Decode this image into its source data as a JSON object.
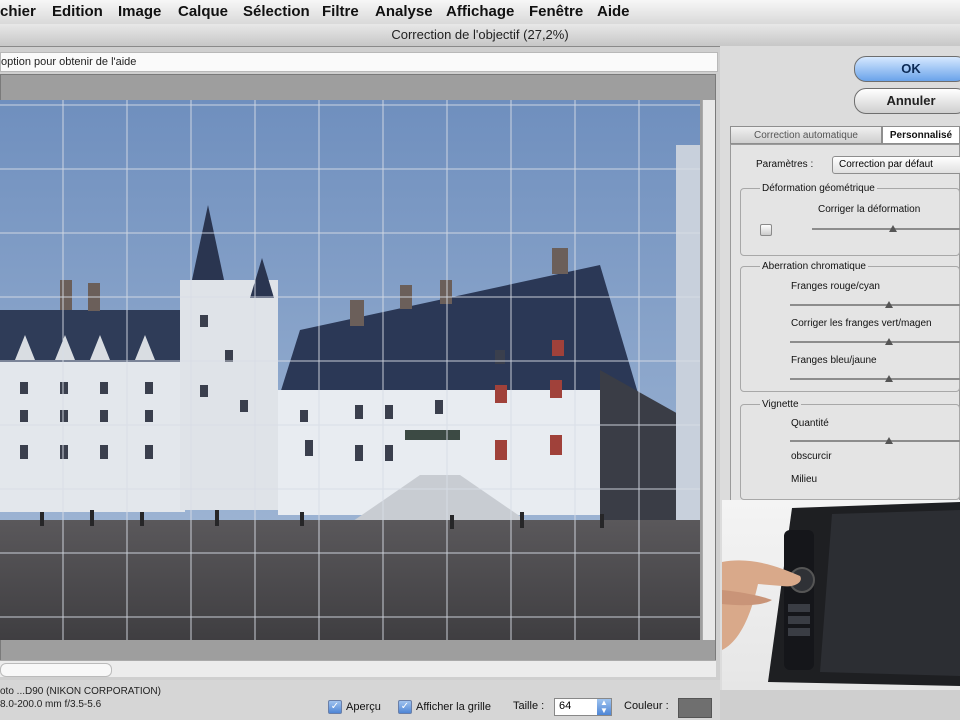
{
  "menu": {
    "items": [
      "chier",
      "Edition",
      "Image",
      "Calque",
      "Sélection",
      "Filtre",
      "Analyse",
      "Affichage",
      "Fenêtre",
      "Aide"
    ]
  },
  "window": {
    "title": "Correction de l'objectif (27,2%)"
  },
  "hint": {
    "text": "option pour obtenir de l'aide"
  },
  "buttons": {
    "ok": "OK",
    "cancel": "Annuler"
  },
  "tabs": {
    "auto": "Correction automatique",
    "custom": "Personnalisé"
  },
  "params": {
    "label": "Paramètres :",
    "value": "Correction par défaut"
  },
  "geometric": {
    "title": "Déformation géométrique",
    "slider_label": "Corriger la déformation",
    "slider_value": 0.55
  },
  "chromatic": {
    "title": "Aberration chromatique",
    "red_cyan": "Franges rouge/cyan",
    "green_magenta": "Corriger les franges vert/magen",
    "blue_yellow": "Franges bleu/jaune",
    "red_cyan_value": 0.58,
    "green_magenta_value": 0.58,
    "blue_yellow_value": 0.58
  },
  "vignette": {
    "title": "Vignette",
    "amount": "Quantité",
    "darken": "obscurcir",
    "midpoint": "Milieu",
    "amount_value": 0.58
  },
  "camera_info": {
    "line1": "oto ...D90 (NIKON CORPORATION)",
    "line2": "8.0-200.0 mm f/3.5-5.6"
  },
  "options": {
    "preview": "Aperçu",
    "show_grid": "Afficher la grille",
    "size_label": "Taille :",
    "size_value": "64",
    "color_label": "Couleur :"
  },
  "colors": {
    "sky": "#7f9cc5",
    "roof": "#2f3f5c",
    "facade": "#e9edf2",
    "ground": "#4c4b4e"
  }
}
